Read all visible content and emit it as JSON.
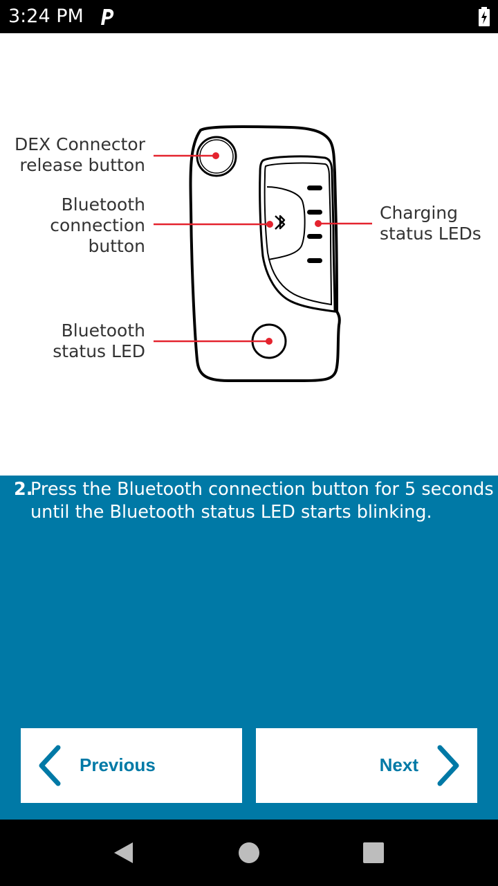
{
  "status_bar": {
    "time": "3:24 PM",
    "icons": [
      "parking-icon",
      "battery-charging-icon"
    ]
  },
  "illustration": {
    "callouts": {
      "dex_release": [
        "DEX Connector",
        "release button"
      ],
      "bt_connection": [
        "Bluetooth",
        "connection",
        "button"
      ],
      "bt_status": [
        "Bluetooth",
        "status LED"
      ],
      "charging": [
        "Charging",
        "status LEDs"
      ]
    }
  },
  "instructions": {
    "step_number": "2.",
    "step_text": "Press the Bluetooth connection button for 5 seconds until the Bluetooth status LED starts blinking."
  },
  "buttons": {
    "previous_label": "Previous",
    "next_label": "Next"
  },
  "colors": {
    "accent": "#0079a6",
    "callout_line": "#e4232e",
    "bar_bg": "#000000"
  },
  "nav_bar": {
    "icons": [
      "back-icon",
      "home-icon",
      "recents-icon"
    ]
  }
}
